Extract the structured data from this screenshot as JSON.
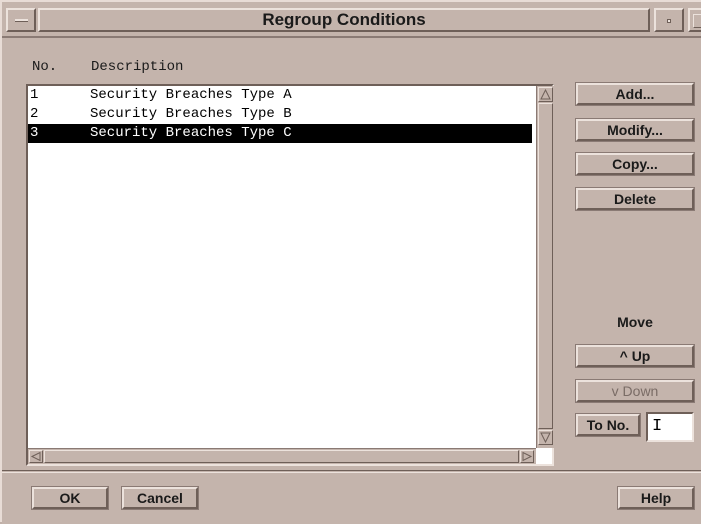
{
  "window": {
    "title": "Regroup Conditions"
  },
  "list": {
    "columns": [
      "No.",
      "Description"
    ],
    "rows": [
      {
        "no": "1",
        "description": "Security Breaches Type A",
        "selected": false
      },
      {
        "no": "2",
        "description": "Security Breaches Type B",
        "selected": false
      },
      {
        "no": "3",
        "description": "Security Breaches Type C",
        "selected": true
      }
    ]
  },
  "actions": {
    "add": "Add...",
    "modify": "Modify...",
    "copy": "Copy...",
    "delete": "Delete"
  },
  "move": {
    "label": "Move",
    "up": "^ Up",
    "down": "v Down",
    "to_no": "To No.",
    "to_no_value": ""
  },
  "footer": {
    "ok": "OK",
    "cancel": "Cancel",
    "help": "Help"
  },
  "colors": {
    "window_bg": "#c4b4ac",
    "selection_bg": "#000000",
    "list_bg": "#ffffff"
  }
}
